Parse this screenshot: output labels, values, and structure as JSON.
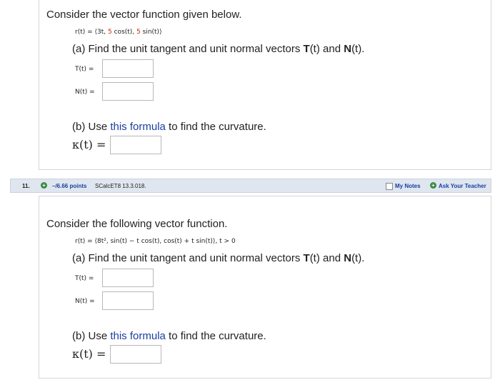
{
  "q1": {
    "intro": "Consider the vector function given below.",
    "vector": {
      "lhs": "r(t) = ⟨3t, ",
      "c1": "5",
      "m1": " cos(t), ",
      "c2": "5",
      "m2": " sin(t)⟩"
    },
    "part_a": {
      "prefix": "(a) Find the unit tangent and unit normal vectors ",
      "T": "T",
      "mid1": "(t) and ",
      "N": "N",
      "suffix": "(t)."
    },
    "T_label": "T(t) =",
    "N_label": "N(t) =",
    "part_b": {
      "prefix": "(b) Use ",
      "link": "this formula",
      "suffix": " to find the curvature."
    },
    "kappa_label": "κ(t) ="
  },
  "q2": {
    "number": "11.",
    "points": "–/6.66 points",
    "source": "SCalcET8 13.3.018.",
    "my_notes": "My Notes",
    "ask_teacher": "Ask Your Teacher",
    "intro": "Consider the following vector function.",
    "vector": "r(t) = ⟨8t², sin(t) − t cos(t), cos(t) + t sin(t)⟩,   t > 0",
    "part_a": {
      "prefix": "(a) Find the unit tangent and unit normal vectors ",
      "T": "T",
      "mid1": "(t) and ",
      "N": "N",
      "suffix": "(t)."
    },
    "T_label": "T(t) =",
    "N_label": "N(t) =",
    "part_b": {
      "prefix": "(b) Use ",
      "link": "this formula",
      "suffix": " to find the curvature."
    },
    "kappa_label": "κ(t) ="
  }
}
